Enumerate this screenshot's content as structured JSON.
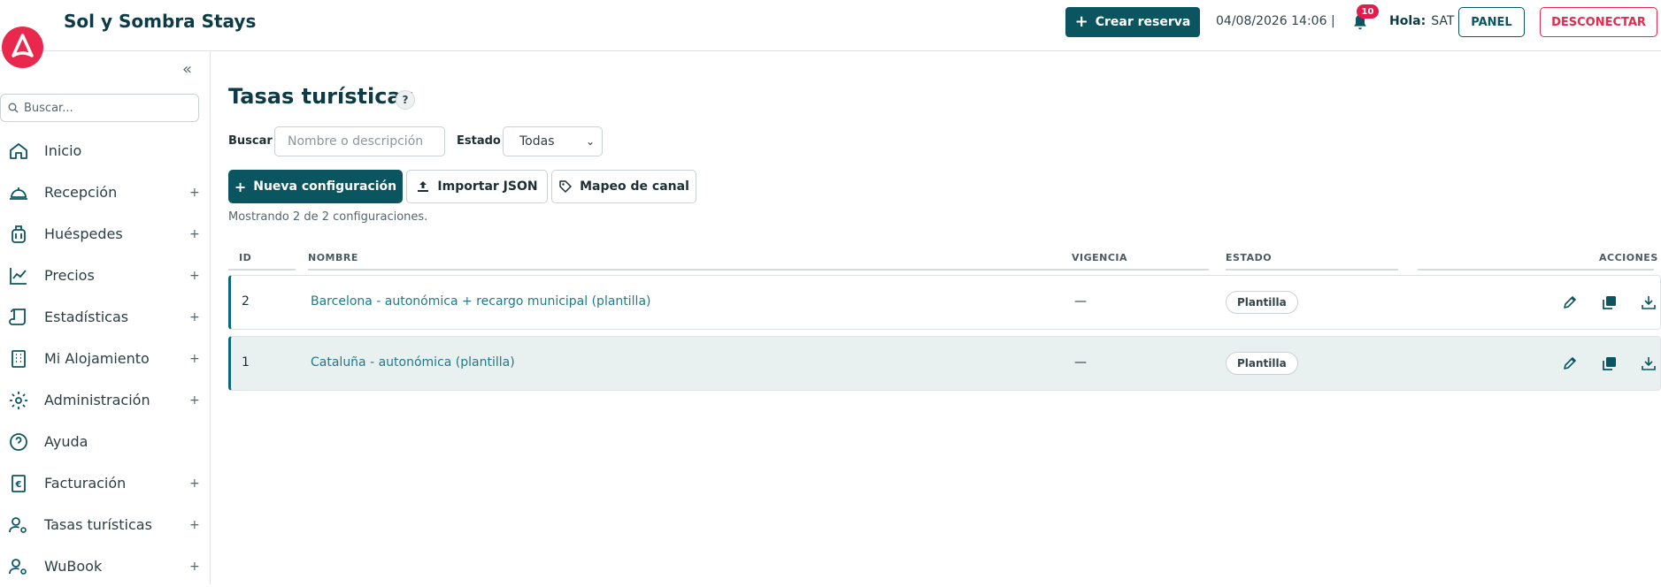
{
  "header": {
    "app_title": "Sol y Sombra Stays",
    "create_label": "Crear reserva",
    "datetime": "04/08/2026 14:06 |",
    "notifications": "10",
    "hola_label": "Hola:",
    "user": "SAT",
    "panel_label": "PANEL",
    "logout_label": "DESCONECTAR"
  },
  "sidebar": {
    "search_placeholder": "Buscar...",
    "items": [
      {
        "label": "Inicio",
        "icon": "home-icon",
        "expandable": false
      },
      {
        "label": "Recepción",
        "icon": "reception-bell-icon",
        "expandable": true
      },
      {
        "label": "Huéspedes",
        "icon": "luggage-icon",
        "expandable": true
      },
      {
        "label": "Precios",
        "icon": "chart-line-icon",
        "expandable": true
      },
      {
        "label": "Estadísticas",
        "icon": "scroll-icon",
        "expandable": true
      },
      {
        "label": "Mi Alojamiento",
        "icon": "building-icon",
        "expandable": true
      },
      {
        "label": "Administración",
        "icon": "gear-icon",
        "expandable": true
      },
      {
        "label": "Ayuda",
        "icon": "help-circle-icon",
        "expandable": false
      },
      {
        "label": "Facturación",
        "icon": "invoice-euro-icon",
        "expandable": true
      },
      {
        "label": "Tasas turísticas",
        "icon": "user-gear-icon",
        "expandable": true
      },
      {
        "label": "WuBook",
        "icon": "user-gear-icon",
        "expandable": true
      }
    ]
  },
  "main": {
    "title": "Tasas turísticas",
    "help": "?",
    "filters": {
      "search_label": "Buscar",
      "search_placeholder": "Nombre o descripción",
      "state_label": "Estado",
      "state_value": "Todas"
    },
    "buttons": {
      "new": "Nueva configuración",
      "import": "Importar JSON",
      "map": "Mapeo de canal"
    },
    "count_text": "Mostrando 2 de 2 configuraciones.",
    "table": {
      "headers": {
        "id": "ID",
        "name": "NOMBRE",
        "vigencia": "VIGENCIA",
        "estado": "ESTADO",
        "acciones": "ACCIONES"
      },
      "rows": [
        {
          "id": "2",
          "name": "Barcelona - autonómica + recargo municipal (plantilla)",
          "vigencia": "—",
          "estado": "Plantilla"
        },
        {
          "id": "1",
          "name": "Cataluña - autonómica (plantilla)",
          "vigencia": "—",
          "estado": "Plantilla"
        }
      ]
    }
  },
  "colors": {
    "brand": "#e8284c",
    "primary": "#0b5560",
    "link": "#1f7a8a"
  }
}
